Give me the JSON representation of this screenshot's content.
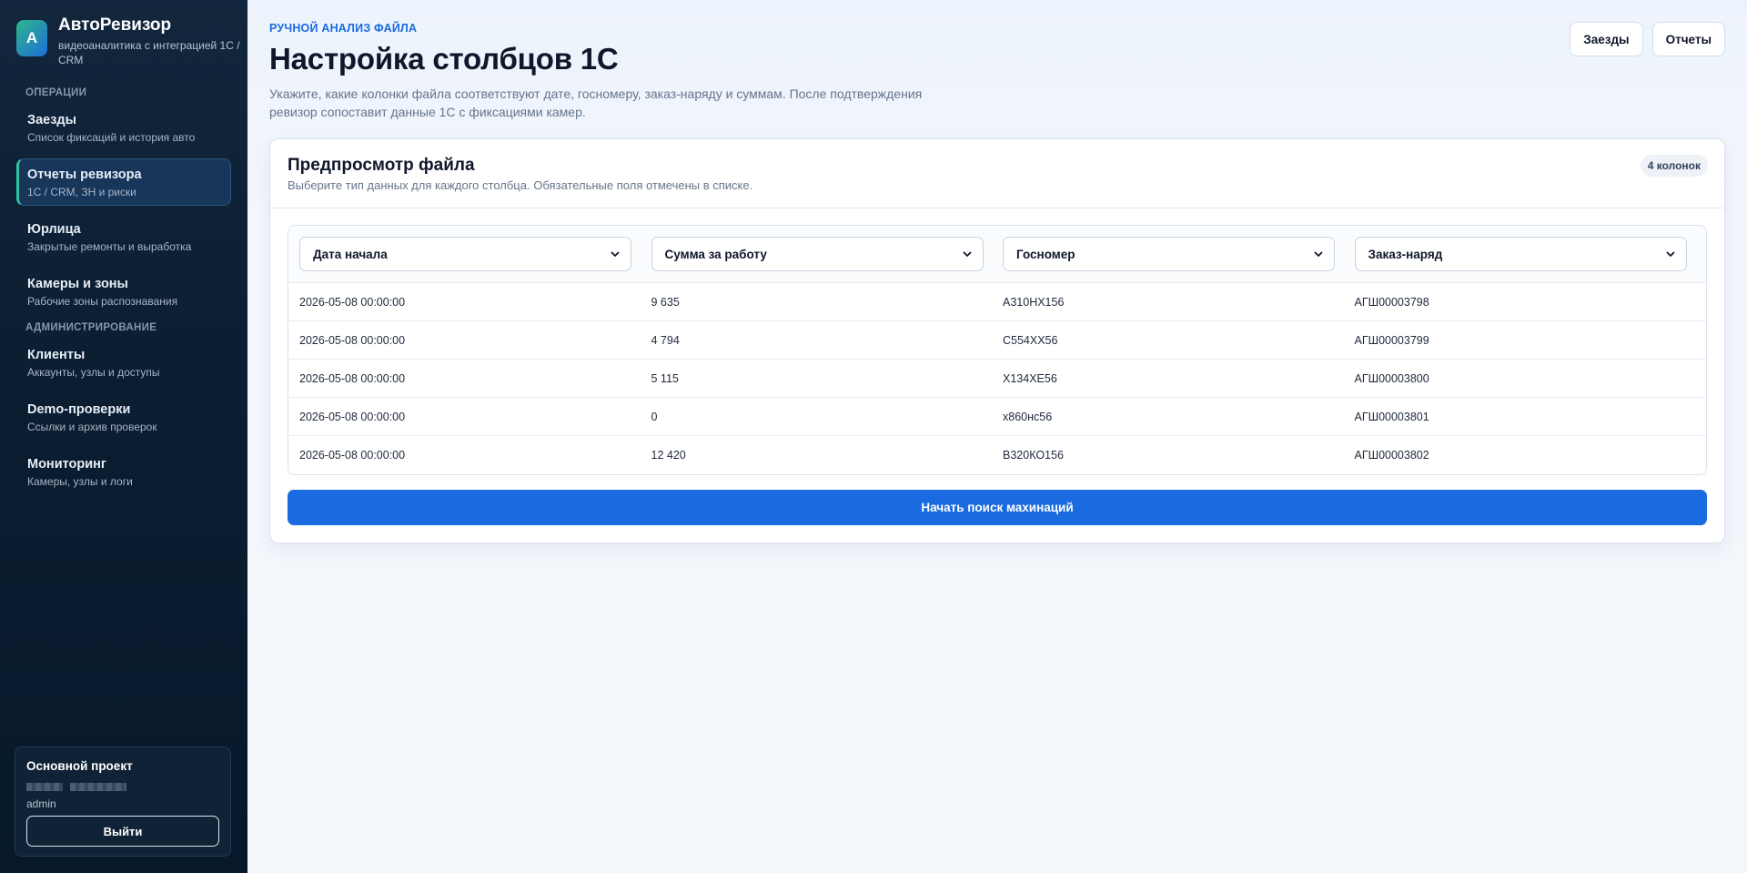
{
  "brand": {
    "logo_letter": "А",
    "title": "АвтоРевизор",
    "subtitle": "видеоаналитика с интеграцией 1С / CRM"
  },
  "sidebar": {
    "section_ops": "ОПЕРАЦИИ",
    "section_admin": "АДМИНИСТРИРОВАНИЕ",
    "items": [
      {
        "title": "Заезды",
        "subtitle": "Список фиксаций и история авто"
      },
      {
        "title": "Отчеты ревизора",
        "subtitle": "1С / CRM, ЗН и риски"
      },
      {
        "title": "Юрлица",
        "subtitle": "Закрытые ремонты и выработка"
      },
      {
        "title": "Камеры и зоны",
        "subtitle": "Рабочие зоны распознавания"
      },
      {
        "title": "Клиенты",
        "subtitle": "Аккаунты, узлы и доступы"
      },
      {
        "title": "Demo-проверки",
        "subtitle": "Ссылки и архив проверок"
      },
      {
        "title": "Мониторинг",
        "subtitle": "Камеры, узлы и логи"
      }
    ],
    "project": {
      "title": "Основной проект",
      "user": "admin",
      "logout": "Выйти"
    }
  },
  "header": {
    "eyebrow": "РУЧНОЙ АНАЛИЗ ФАЙЛА",
    "title": "Настройка столбцов 1С",
    "description": "Укажите, какие колонки файла соответствуют дате, госномеру, заказ-наряду и суммам. После подтверждения ревизор сопоставит данные 1С с фиксациями камер.",
    "actions": [
      "Заезды",
      "Отчеты"
    ]
  },
  "preview": {
    "title": "Предпросмотр файла",
    "subtitle": "Выберите тип данных для каждого столбца. Обязательные поля отмечены в списке.",
    "badge": "4 колонок",
    "columns": [
      "Дата начала",
      "Сумма за работу",
      "Госномер",
      "Заказ-наряд"
    ],
    "rows": [
      [
        "2026-05-08 00:00:00",
        "9 635",
        "А310НХ156",
        "АГШ00003798"
      ],
      [
        "2026-05-08 00:00:00",
        "4 794",
        "С554ХХ56",
        "АГШ00003799"
      ],
      [
        "2026-05-08 00:00:00",
        "5 115",
        "Х134ХЕ56",
        "АГШ00003800"
      ],
      [
        "2026-05-08 00:00:00",
        "0",
        "х860нс56",
        "АГШ00003801"
      ],
      [
        "2026-05-08 00:00:00",
        "12 420",
        "В320КО156",
        "АГШ00003802"
      ]
    ],
    "submit": "Начать поиск махинаций"
  },
  "colors": {
    "accent": "#1a6be0",
    "sidebar_bg": "#0b1d31",
    "active_marker": "#2ec4a0"
  }
}
